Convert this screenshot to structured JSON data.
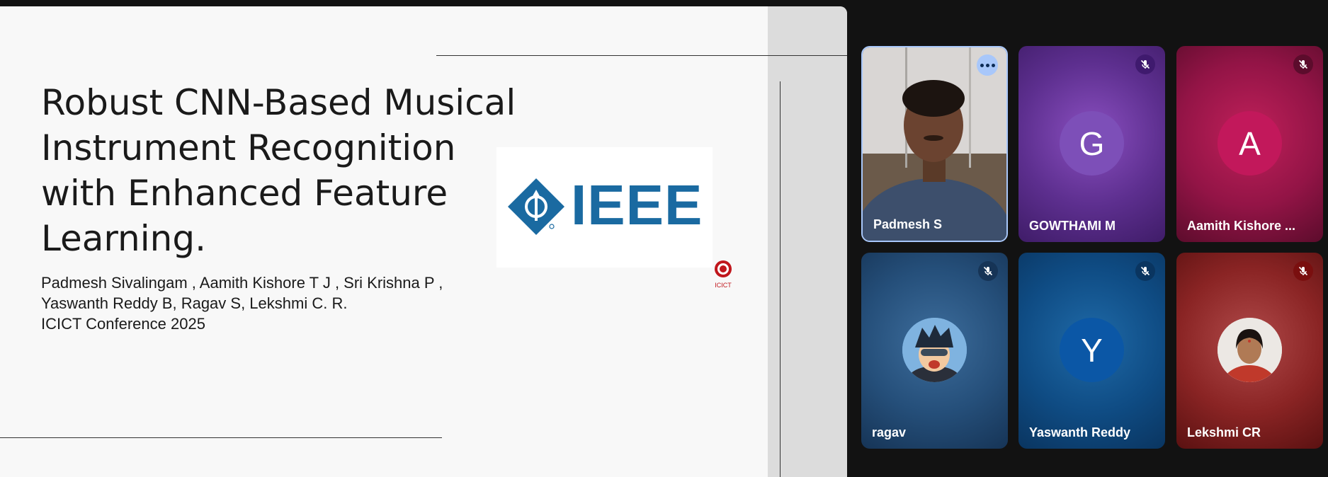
{
  "slide": {
    "title": "Robust CNN-Based Musical Instrument Recognition with Enhanced Feature Learning.",
    "authors": "Padmesh Sivalingam , Aamith Kishore T J , Sri Krishna P , Yaswanth Reddy B, Ragav S, Lekshmi C. R.",
    "conference": "ICICT Conference 2025",
    "logo_text": "IEEE",
    "badge_text": "ICICT",
    "colors": {
      "ieee_blue": "#1a6aa1",
      "icict_red": "#c0161c"
    }
  },
  "participants": [
    {
      "name": "Padmesh S",
      "video": true,
      "muted": false,
      "active_speaker": true,
      "control_icon": "more-options-icon"
    },
    {
      "name": "GOWTHAMI M",
      "initial": "G",
      "muted": true,
      "avatar_color": "#7d4fb8",
      "mic_icon": "mic-off-icon"
    },
    {
      "name": "Aamith Kishore ...",
      "initial": "A",
      "muted": true,
      "avatar_color": "#c2185b",
      "mic_icon": "mic-off-icon"
    },
    {
      "name": "ragav",
      "avatar_image": "cartoon-avatar",
      "muted": true,
      "mic_icon": "mic-off-icon"
    },
    {
      "name": "Yaswanth Reddy",
      "initial": "Y",
      "muted": true,
      "avatar_color": "#0b57a6",
      "mic_icon": "mic-off-icon"
    },
    {
      "name": "Lekshmi CR",
      "avatar_image": "profile-photo",
      "muted": true,
      "mic_icon": "mic-off-icon"
    }
  ]
}
